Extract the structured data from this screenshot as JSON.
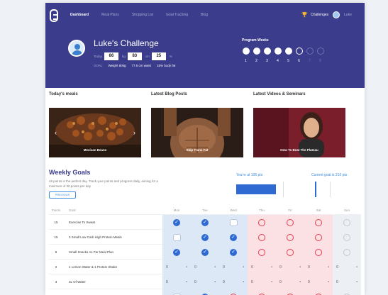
{
  "nav": {
    "links": [
      "Dashboard",
      "Meal Plans",
      "Shopping List",
      "Goal Tracking",
      "Blog"
    ],
    "challenges_label": "Challenges",
    "user_label": "Luke"
  },
  "hero": {
    "title": "Luke's Challenge",
    "today_label": "Today",
    "weight_value": "86",
    "weight_unit": "kg",
    "waist_value": "83",
    "waist_unit": "cm",
    "bodyfat_value": "25",
    "bodyfat_unit": "%",
    "goals_label": "GOAL",
    "goal_weight": "Weight 80kg",
    "goal_waist": "77.5 cm waist",
    "goal_bodyfat": "15% body fat",
    "program_label": "Program Weeks",
    "weeks": [
      {
        "num": "1",
        "state": "done"
      },
      {
        "num": "2",
        "state": "done"
      },
      {
        "num": "3",
        "state": "done"
      },
      {
        "num": "4",
        "state": "done"
      },
      {
        "num": "5",
        "state": "done"
      },
      {
        "num": "6",
        "state": "current"
      },
      {
        "num": "7",
        "state": "future"
      },
      {
        "num": "8",
        "state": "future"
      }
    ]
  },
  "sections": {
    "meals_title": "Today's meals",
    "meal_caption": "Mexican Beans",
    "blog_title": "Latest Blog Posts",
    "blog_caption": "Skip Trans Fat",
    "videos_title": "Latest Videos & Seminars",
    "video_caption": "How To Beat The Plateau"
  },
  "weekly": {
    "title": "Weekly Goals",
    "description": "45 points is the perfect day. Track your points and progress daily, aiming for a minimum of 30 points per day",
    "previous_label": "PREVIOUS",
    "you_label": "You're at 106 pts",
    "goal_label": "Current goal is 210 pts",
    "current_points": 106,
    "goal_points": 210
  },
  "table": {
    "headers": [
      "Points",
      "Goal",
      "Mon",
      "Tue",
      "Wed",
      "Thu",
      "Fri",
      "Sat",
      "Sun"
    ],
    "rows": [
      {
        "points": "15",
        "goal": "Exercise To Sweat",
        "cells": [
          "check",
          "check",
          "pending",
          "ring",
          "ring",
          "ring",
          "grey"
        ]
      },
      {
        "points": "15",
        "goal": "3 Small Low Carb High Protein Meals",
        "cells": [
          "pending",
          "check",
          "check",
          "ring",
          "ring",
          "ring",
          "grey"
        ]
      },
      {
        "points": "5",
        "goal": "Small Snacks As Per Meal Plan",
        "cells": [
          "check",
          "check",
          "check",
          "ring",
          "ring",
          "ring",
          "grey"
        ]
      },
      {
        "points": "2",
        "goal": "1 Lemon Water & 1 Protein Shake",
        "cells": [
          "stepper",
          "stepper",
          "stepper",
          "stepper",
          "stepper",
          "stepper",
          "stepper"
        ]
      },
      {
        "points": "3",
        "goal": "3L Of Water",
        "cells": [
          "stepper",
          "stepper",
          "stepper",
          "stepper",
          "stepper",
          "stepper",
          "stepper"
        ]
      },
      {
        "points": "5",
        "goal": "8 Hours Of Sleep",
        "cells": [
          "pending",
          "check",
          "ring",
          "ring",
          "ring",
          "ring",
          "grey"
        ]
      }
    ],
    "stepper_value": "0",
    "stepper_minus": "−",
    "stepper_plus": "+"
  },
  "colors": {
    "brand": "#3b3c8c",
    "accent": "#2e6ad1",
    "miss": "#e6394a"
  }
}
